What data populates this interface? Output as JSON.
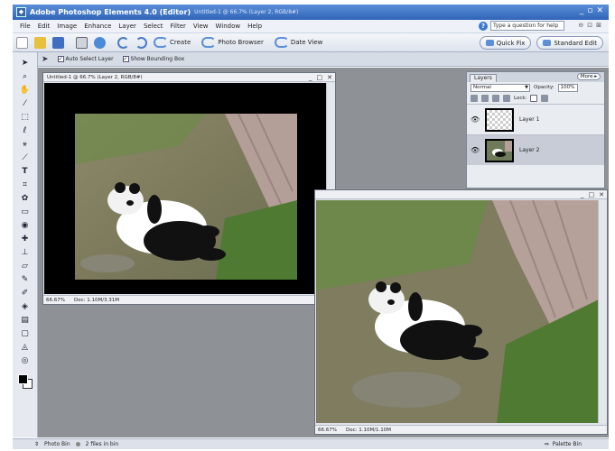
{
  "window": {
    "title": "Adobe Photoshop Elements 4.0 (Editor)",
    "subtitle": "Untitled-1 @ 66.7% (Layer 2, RGB/8#)",
    "controls": [
      "_",
      "▫",
      "✕"
    ]
  },
  "menu": {
    "items": [
      "File",
      "Edit",
      "Image",
      "Enhance",
      "Layer",
      "Select",
      "Filter",
      "View",
      "Window",
      "Help"
    ],
    "help_placeholder": "Type a question for help"
  },
  "shortcuts": {
    "create_label": "Create",
    "photo_browser_label": "Photo Browser",
    "date_view_label": "Date View",
    "quick_fix_label": "Quick Fix",
    "standard_edit_label": "Standard Edit"
  },
  "options": {
    "auto_select_label": "Auto Select Layer",
    "show_bounding_label": "Show Bounding Box"
  },
  "doc1": {
    "title": "Untitled-1 @ 66.7% (Layer 2, RGB/8#)",
    "zoom": "66.67%",
    "doc_size": "Doc: 1.10M/3.31M"
  },
  "doc2": {
    "zoom": "66.67%",
    "doc_size": "Doc: 1.10M/1.10M"
  },
  "layers": {
    "tab_label": "Layers",
    "more_label": "More ▸",
    "blend_mode": "Normal",
    "opacity_label": "Opacity:",
    "opacity_value": "100%",
    "lock_label": "Lock:",
    "rows": [
      {
        "name": "Layer 1"
      },
      {
        "name": "Layer 2"
      }
    ]
  },
  "status": {
    "photo_bin_label": "Photo Bin",
    "files_in_bin": "2 files in bin",
    "palette_bin_label": "Palette Bin"
  },
  "colors": {
    "foreground": "#000000",
    "background": "#ffffff",
    "workspace": "#8e9297",
    "title_bar": "#2f64b8"
  }
}
